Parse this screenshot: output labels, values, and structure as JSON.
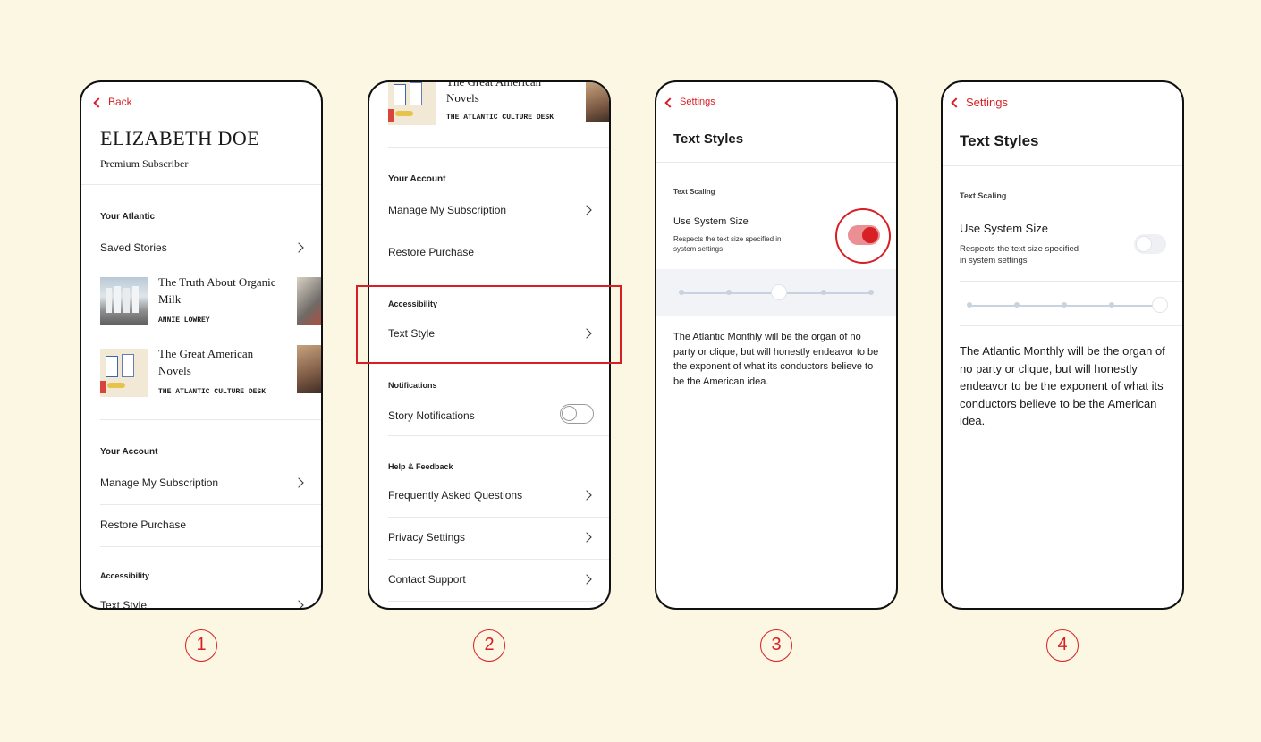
{
  "phone1": {
    "back_label": "Back",
    "profile_name": "ELIZABETH DOE",
    "profile_tier": "Premium Subscriber",
    "your_atlantic_header": "Your Atlantic",
    "saved_stories_label": "Saved Stories",
    "stories": [
      {
        "title_line1": "The Truth About Organic",
        "title_line2": "Milk",
        "author": "ANNIE LOWREY"
      },
      {
        "title_line1": "The Great American",
        "title_line2": "Novels",
        "author": "THE ATLANTIC CULTURE DESK"
      }
    ],
    "your_account_header": "Your Account",
    "manage_subscription_label": "Manage My Subscription",
    "restore_purchase_label": "Restore Purchase",
    "accessibility_header": "Accessibility",
    "text_style_label": "Text Style"
  },
  "phone2": {
    "story_title_line1": "The Great American",
    "story_title_line2": "Novels",
    "story_author": "THE ATLANTIC CULTURE DESK",
    "your_account_header": "Your Account",
    "manage_subscription_label": "Manage My Subscription",
    "restore_purchase_label": "Restore Purchase",
    "accessibility_header": "Accessibility",
    "text_style_label": "Text Style",
    "notifications_header": "Notifications",
    "story_notifications_label": "Story Notifications",
    "story_notifications_on": false,
    "help_header": "Help & Feedback",
    "faq_label": "Frequently Asked Questions",
    "privacy_label": "Privacy Settings",
    "contact_label": "Contact Support"
  },
  "phone3": {
    "back_label": "Settings",
    "title": "Text Styles",
    "scaling_header": "Text Scaling",
    "system_size_label": "Use System Size",
    "system_size_desc_line1": "Respects the text size specified in",
    "system_size_desc_line2": "system settings",
    "system_size_on": true,
    "slider_level": 3,
    "slider_steps": 5,
    "sample_text": "The Atlantic Monthly will be the organ of no party or clique, but will honestly endeavor to be the exponent of what its conductors believe to be the American idea."
  },
  "phone4": {
    "back_label": "Settings",
    "title": "Text Styles",
    "scaling_header": "Text Scaling",
    "system_size_label": "Use System Size",
    "system_size_desc_line1": "Respects the text size specified",
    "system_size_desc_line2": "in system settings",
    "system_size_on": false,
    "slider_level": 5,
    "slider_steps": 5,
    "sample_text": "The Atlantic Monthly will be the organ of no party or clique, but will honestly endeavor to be the exponent of what its conductors believe to be the American idea."
  },
  "step_numbers": [
    "1",
    "2",
    "3",
    "4"
  ],
  "colors": {
    "background": "#fbf7e3",
    "accent_red": "#d81f26",
    "text": "#1a1a1a",
    "slider_gray": "#c9d3e0"
  }
}
